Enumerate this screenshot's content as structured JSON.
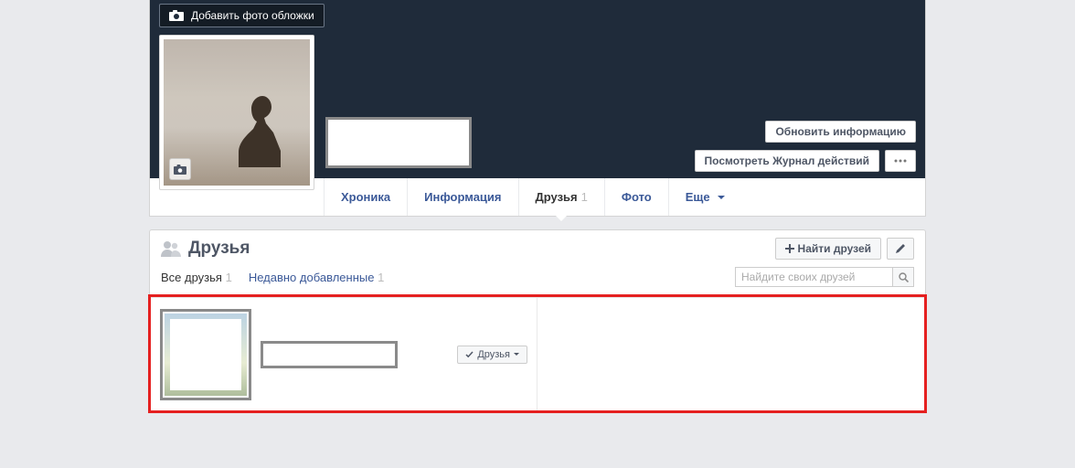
{
  "cover": {
    "add_cover_label": "Добавить фото обложки",
    "update_info_label": "Обновить информацию",
    "activity_log_label": "Посмотреть Журнал действий"
  },
  "tabs": {
    "timeline": "Хроника",
    "about": "Информация",
    "friends": "Друзья",
    "friends_count": "1",
    "photos": "Фото",
    "more": "Еще"
  },
  "friends_panel": {
    "title": "Друзья",
    "find_friends_label": "Найти друзей",
    "all_friends": "Все друзья",
    "all_friends_count": "1",
    "recent": "Недавно добавленные",
    "recent_count": "1",
    "search_placeholder": "Найдите своих друзей",
    "friend_button_label": "Друзья"
  }
}
